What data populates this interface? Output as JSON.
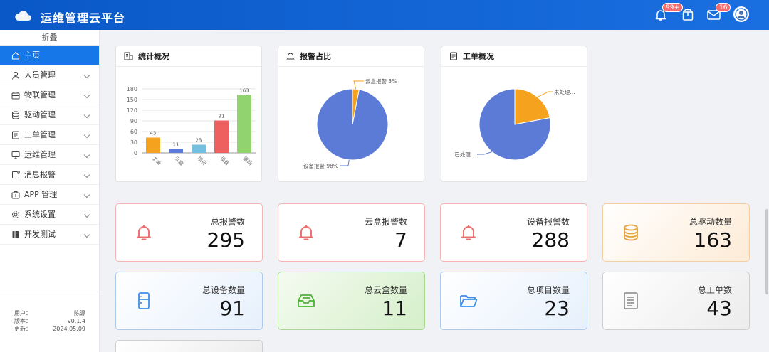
{
  "app": {
    "title": "运维管理云平台"
  },
  "header": {
    "notifications_badge": "99+",
    "messages_badge": "16"
  },
  "sidebar": {
    "collapse_label": "折叠",
    "items": [
      {
        "label": "主页",
        "icon": "home-icon",
        "active": true
      },
      {
        "label": "人员管理",
        "icon": "user-icon"
      },
      {
        "label": "物联管理",
        "icon": "device-icon"
      },
      {
        "label": "驱动管理",
        "icon": "database-icon"
      },
      {
        "label": "工单管理",
        "icon": "document-icon"
      },
      {
        "label": "运维管理",
        "icon": "monitor-icon"
      },
      {
        "label": "消息报警",
        "icon": "message-icon"
      },
      {
        "label": "APP 管理",
        "icon": "app-icon"
      },
      {
        "label": "系统设置",
        "icon": "gear-icon"
      },
      {
        "label": "开发测试",
        "icon": "book-icon"
      }
    ],
    "info": {
      "user_label": "用户：",
      "user_value": "陈源",
      "version_label": "版本：",
      "version_value": "v0.1.4",
      "updated_label": "更新：",
      "updated_value": "2024.05.09"
    }
  },
  "panels": {
    "stats": {
      "title": "统计概况"
    },
    "alarm_ratio": {
      "title": "报警占比"
    },
    "work_orders": {
      "title": "工单概况"
    }
  },
  "chart_data": [
    {
      "type": "bar",
      "categories": [
        "工单",
        "云盒",
        "项目",
        "设备",
        "驱动"
      ],
      "values": [
        43,
        11,
        23,
        91,
        163
      ],
      "colors": [
        "#f5a21f",
        "#5b7bd6",
        "#73c0de",
        "#ee5f5f",
        "#91d46f"
      ],
      "yticks": [
        0,
        30,
        60,
        90,
        120,
        150,
        180
      ],
      "ylim": [
        0,
        180
      ],
      "grid": true
    },
    {
      "type": "pie",
      "slices": [
        {
          "label": "云盒报警 3%",
          "value": 3,
          "color": "#f5a21f"
        },
        {
          "label": "设备报警 98%",
          "value": 97,
          "color": "#5b7bd6"
        }
      ]
    },
    {
      "type": "pie",
      "slices": [
        {
          "label": "未处理...",
          "value": 22,
          "color": "#f5a21f"
        },
        {
          "label": "已处理...",
          "value": 78,
          "color": "#5b7bd6"
        }
      ]
    }
  ],
  "cards": [
    {
      "label": "总报警数",
      "value": "295",
      "icon": "bell-icon",
      "color": "#ee6f6f"
    },
    {
      "label": "云盒报警数",
      "value": "7",
      "icon": "bell-icon",
      "color": "#ee6f6f"
    },
    {
      "label": "设备报警数",
      "value": "288",
      "icon": "bell-icon",
      "color": "#ee6f6f"
    },
    {
      "label": "总驱动数量",
      "value": "163",
      "icon": "coins-icon",
      "color": "#e8a23a"
    },
    {
      "label": "总设备数量",
      "value": "91",
      "icon": "device-icon",
      "color": "#3d8fe8"
    },
    {
      "label": "总云盒数量",
      "value": "11",
      "icon": "inbox-icon",
      "color": "#4fb03a"
    },
    {
      "label": "总项目数量",
      "value": "23",
      "icon": "folder-icon",
      "color": "#3d8fe8"
    },
    {
      "label": "总工单数",
      "value": "43",
      "icon": "document-icon",
      "color": "#888888"
    }
  ]
}
